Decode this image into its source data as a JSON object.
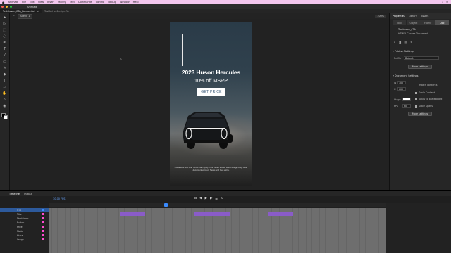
{
  "menubar": {
    "app_name": "Animate",
    "items": [
      "File",
      "Edit",
      "View",
      "Insert",
      "Modify",
      "Text",
      "Commands",
      "Control",
      "Debug",
      "Window",
      "Help"
    ]
  },
  "app": {
    "title": "Animate"
  },
  "tabs": [
    {
      "label": "TestHuson_CTA_Banner.fla*",
      "active": true
    },
    {
      "label": "TestAnHoLDesign.fla",
      "active": false
    }
  ],
  "editbar": {
    "scene": "Scene 1",
    "zoom": "100%"
  },
  "ad": {
    "title": "2023 Huson Hercules",
    "subtitle": "10% off MSRP",
    "cta": "GET PRICE",
    "disclaimer": "Conditions and offer terms may apply. This model shown is the design-only, other document version. Taxes and fees extra."
  },
  "properties": {
    "panel_tabs": [
      "Properties",
      "Library",
      "Assets"
    ],
    "sub_tabs": [
      "Tool",
      "Object",
      "Frame",
      "Doc"
    ],
    "doc_name": "TestHuson_CTA",
    "doc_type": "HTML5 Canvas Document",
    "publish_section": "Publish Settings",
    "profile_label": "Profile",
    "profile_value": "Default",
    "more_settings": "More settings",
    "document_section": "Document Settings",
    "width_label": "W",
    "width": "300",
    "height_label": "H",
    "height": "600",
    "match_contents": "Match contents",
    "scale_content": "Scale Content",
    "stage_label": "Stage",
    "apply_pasteboard": "Apply to pasteboard",
    "fps_label": "FPS",
    "fps": "30",
    "scale_spans": "Scale Spans",
    "more_settings_2": "More settings"
  },
  "timeline": {
    "tabs": [
      "Timeline",
      "Output"
    ],
    "fps": "30.00 FPS",
    "layers": [
      {
        "name": "CTA",
        "color": "#3a8bff"
      },
      {
        "name": "Title",
        "color": "#ff4ad0"
      },
      {
        "name": "Disclaimer",
        "color": "#ff4ad0"
      },
      {
        "name": "Button",
        "color": "#ff4ad0"
      },
      {
        "name": "Price",
        "color": "#ff4ad0"
      },
      {
        "name": "Model",
        "color": "#ff4ad0"
      },
      {
        "name": "Lines",
        "color": "#ff4ad0"
      },
      {
        "name": "Image",
        "color": "#ff4ad0"
      }
    ]
  },
  "colors": {
    "accent": "#3a8bff",
    "keyframe": "#8a5cc8",
    "menubar": "#f3c6ee"
  }
}
